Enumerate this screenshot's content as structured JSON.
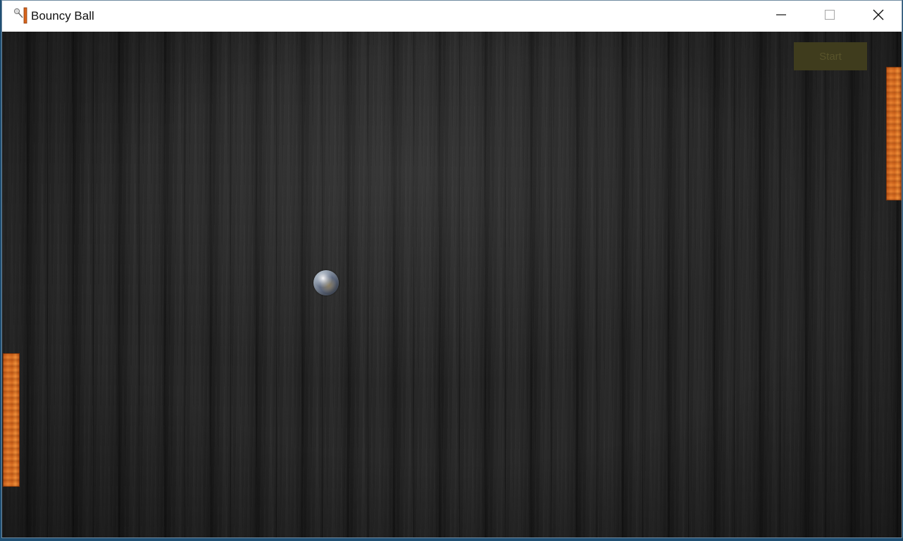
{
  "window": {
    "title": "Bouncy Ball",
    "app_icon": "bouncy-ball-app-icon",
    "controls": {
      "minimize_icon": "minimize-icon",
      "maximize_icon": "maximize-icon",
      "close_icon": "close-icon"
    }
  },
  "game": {
    "start_button_label": "Start",
    "paddle_color": "#d2641b",
    "start_button_color": "#3f3c1d",
    "background": "dark-wood-planks"
  }
}
